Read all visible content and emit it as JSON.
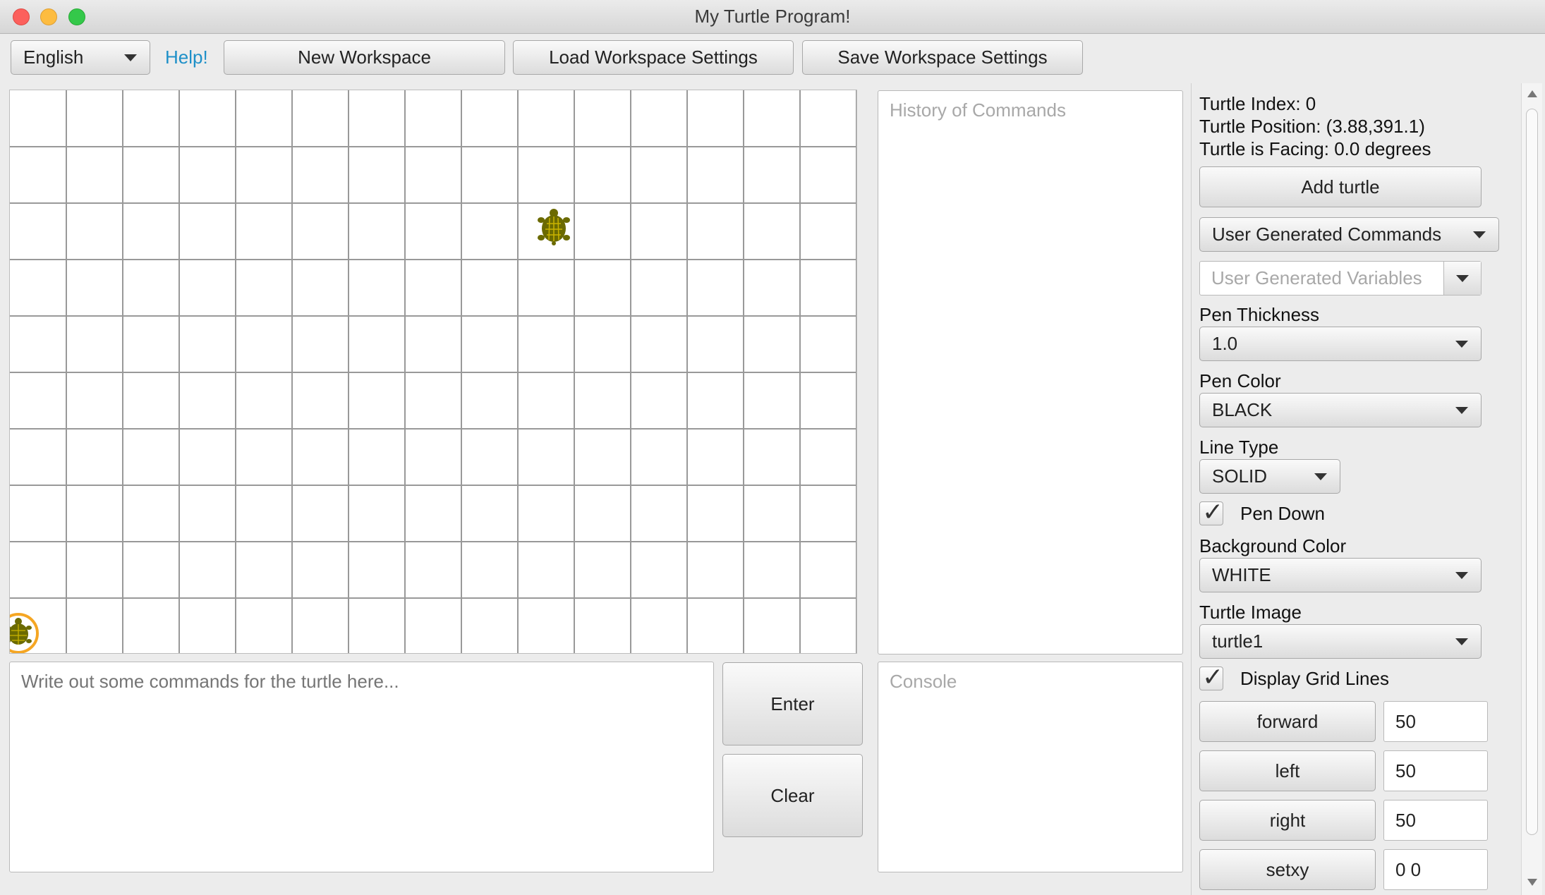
{
  "window": {
    "title": "My Turtle Program!"
  },
  "toolbar": {
    "language": "English",
    "help": "Help!",
    "new_workspace": "New Workspace",
    "load_settings": "Load Workspace Settings",
    "save_settings": "Save Workspace Settings"
  },
  "history": {
    "placeholder": "History of Commands"
  },
  "command_input": {
    "placeholder": "Write out some commands for the turtle here...",
    "value": ""
  },
  "actions": {
    "enter": "Enter",
    "clear": "Clear"
  },
  "console": {
    "placeholder": "Console"
  },
  "panel": {
    "turtle_index": "Turtle Index: 0",
    "turtle_position": "Turtle Position: (3.88,391.1)",
    "turtle_facing": "Turtle is Facing: 0.0 degrees",
    "add_turtle": "Add turtle",
    "user_commands": "User Generated Commands",
    "user_variables_placeholder": "User Generated Variables",
    "pen_thickness_label": "Pen Thickness",
    "pen_thickness": "1.0",
    "pen_color_label": "Pen Color",
    "pen_color": "BLACK",
    "line_type_label": "Line Type",
    "line_type": "SOLID",
    "pen_down_label": "Pen Down",
    "pen_down": true,
    "background_color_label": "Background Color",
    "background_color": "WHITE",
    "turtle_image_label": "Turtle Image",
    "turtle_image": "turtle1",
    "grid_lines_label": "Display Grid Lines",
    "grid_lines": true,
    "quick_commands": [
      {
        "label": "forward",
        "value": "50"
      },
      {
        "label": "left",
        "value": "50"
      },
      {
        "label": "right",
        "value": "50"
      },
      {
        "label": "setxy",
        "value": "0 0"
      }
    ]
  },
  "colors": {
    "accent": "#1e90c8",
    "turtle": "#6b6a00",
    "selection_ring": "#f5a623",
    "grid": "#999999"
  }
}
